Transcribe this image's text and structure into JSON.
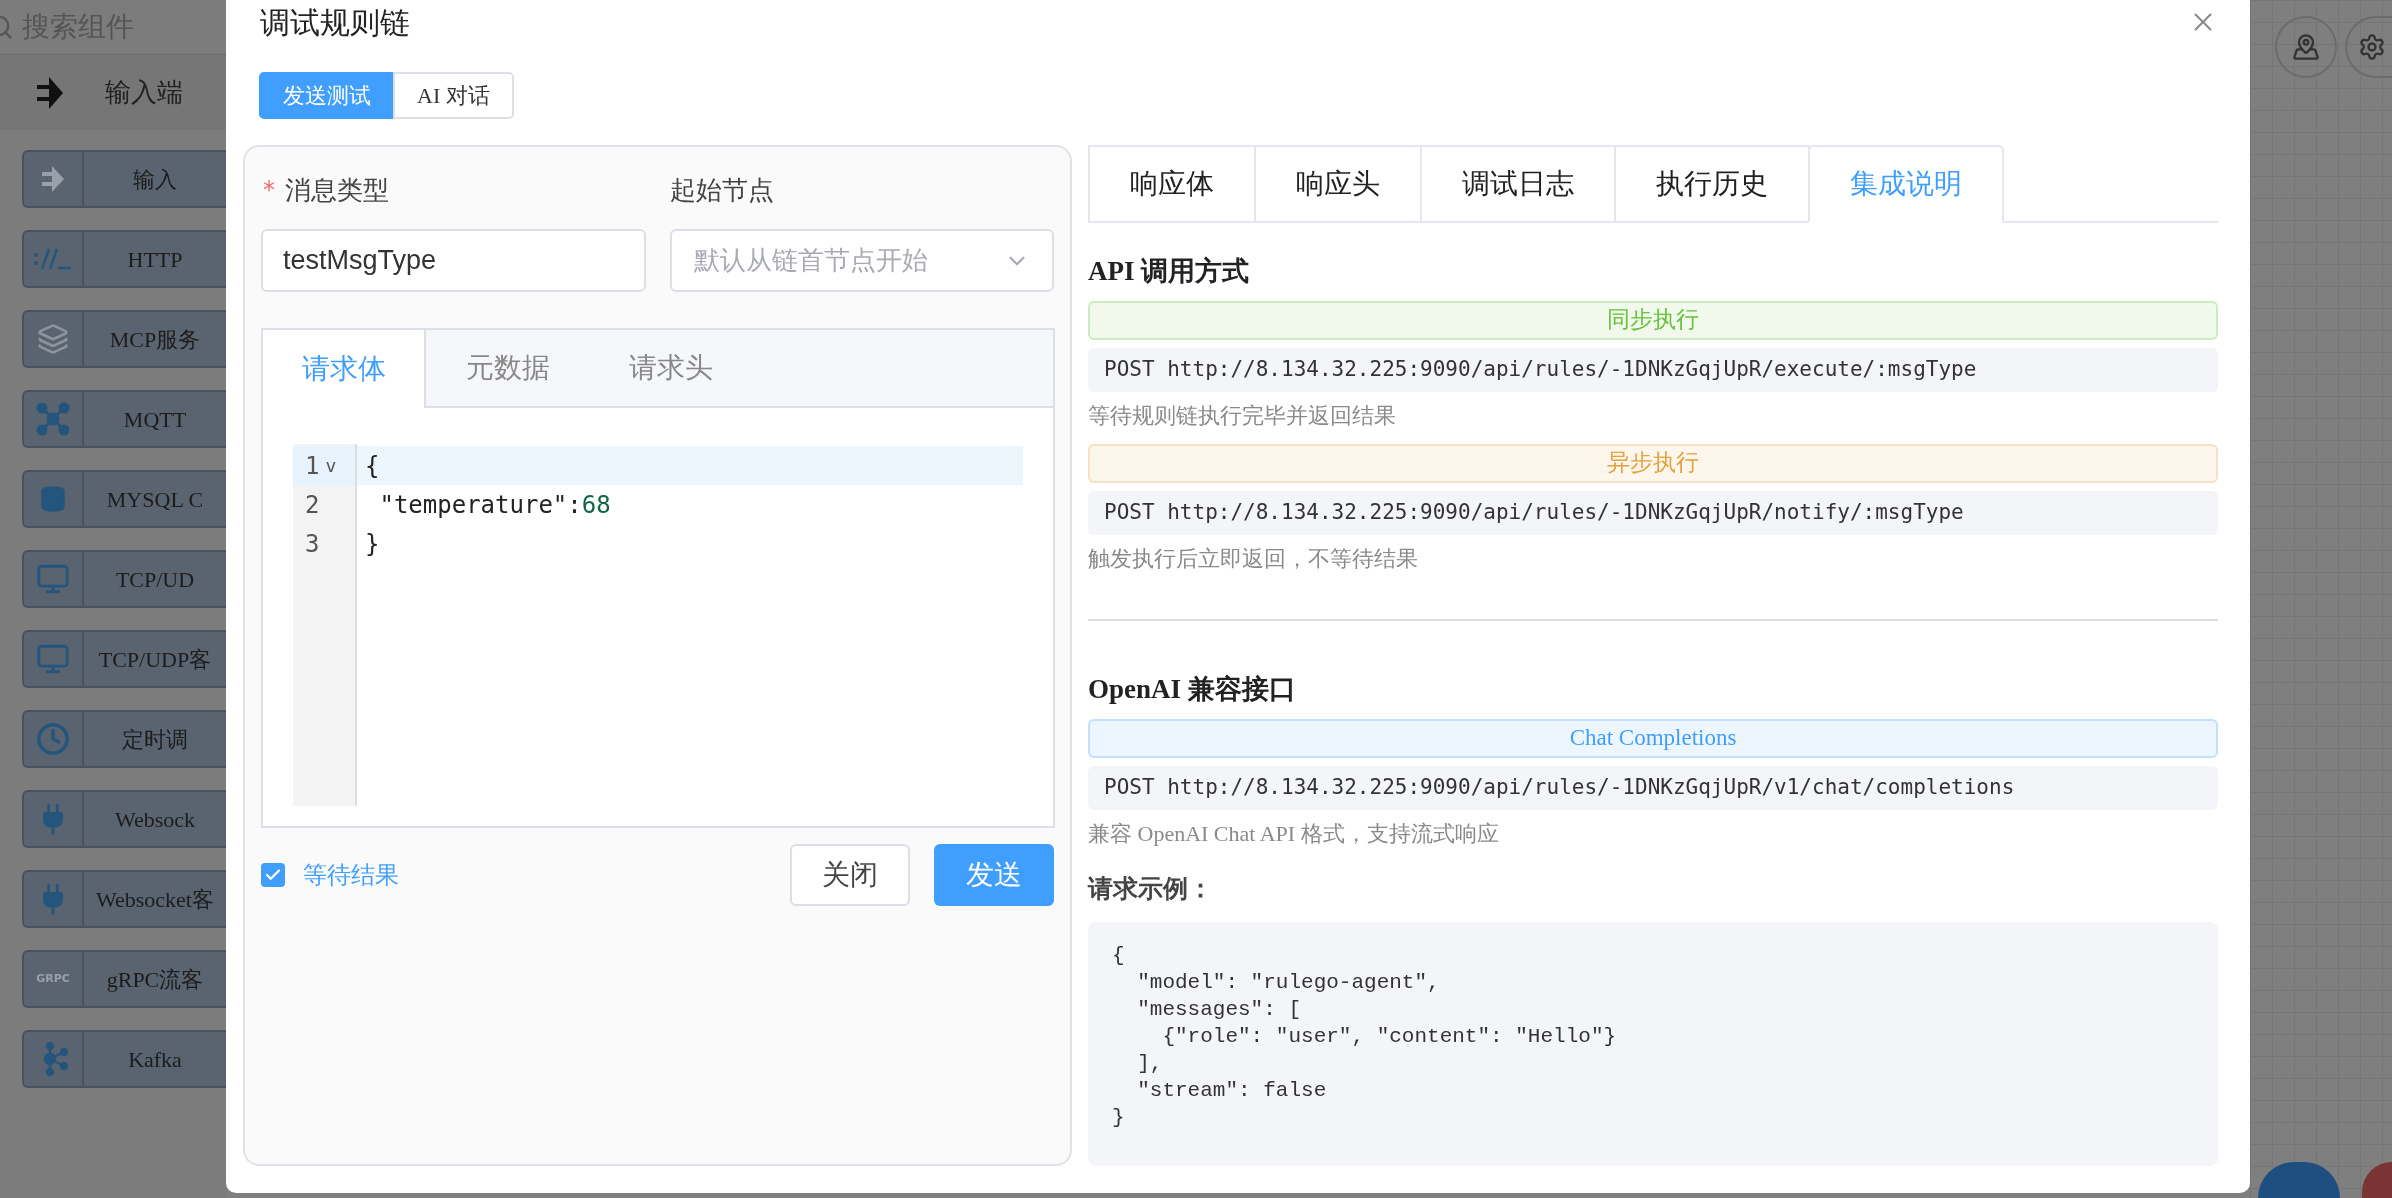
{
  "sidebar": {
    "search_placeholder": "搜索组件",
    "group": {
      "label": "输入端"
    },
    "items": [
      {
        "label": "输入",
        "kind": "arrow"
      },
      {
        "label": "HTTP",
        "kind": "http"
      },
      {
        "label": "MCP服务",
        "kind": "layers"
      },
      {
        "label": "MQTT",
        "kind": "hub"
      },
      {
        "label": "MYSQL C",
        "kind": "database"
      },
      {
        "label": "TCP/UD",
        "kind": "monitors"
      },
      {
        "label": "TCP/UDP客",
        "kind": "monitors"
      },
      {
        "label": "定时调",
        "kind": "clock"
      },
      {
        "label": "Websock",
        "kind": "plug"
      },
      {
        "label": "Websocket客",
        "kind": "plug"
      },
      {
        "label": "gRPC流客",
        "kind": "grpc",
        "icon_text": "GRPC"
      },
      {
        "label": "Kafka",
        "kind": "cluster"
      }
    ]
  },
  "dialog": {
    "title": "调试规则链",
    "mode_tabs": [
      {
        "label": "发送测试",
        "selected": true
      },
      {
        "label": "AI 对话",
        "selected": false
      }
    ],
    "message_type": {
      "label": "消息类型",
      "required_mark": "*",
      "value": "testMsgType"
    },
    "start_node": {
      "label": "起始节点",
      "placeholder": "默认从链首节点开始"
    },
    "body_tabs": [
      {
        "label": "请求体",
        "selected": true
      },
      {
        "label": "元数据",
        "selected": false
      },
      {
        "label": "请求头",
        "selected": false
      }
    ],
    "editor_lines": [
      {
        "number": "1",
        "fold_marker": "v",
        "active": true,
        "segments": [
          {
            "text": "{",
            "kind": "punct"
          }
        ]
      },
      {
        "number": "2",
        "active": false,
        "segments": [
          {
            "text": " \"temperature\"",
            "kind": "key"
          },
          {
            "text": ":",
            "kind": "punct"
          },
          {
            "text": "68",
            "kind": "number"
          }
        ]
      },
      {
        "number": "3",
        "active": false,
        "segments": [
          {
            "text": "}",
            "kind": "punct"
          }
        ]
      }
    ],
    "wait_result": {
      "label": "等待结果",
      "checked": true
    },
    "buttons": [
      {
        "label": "关闭",
        "kind": "default"
      },
      {
        "label": "发送",
        "kind": "primary"
      }
    ],
    "result_tabs": [
      {
        "label": "响应体",
        "selected": false
      },
      {
        "label": "响应头",
        "selected": false
      },
      {
        "label": "调试日志",
        "selected": false
      },
      {
        "label": "执行历史",
        "selected": false
      },
      {
        "label": "集成说明",
        "selected": true
      }
    ],
    "sections": [
      {
        "heading": "API 调用方式",
        "endpoints": [
          {
            "label": "同步执行",
            "color": "#67c23a",
            "request": "POST http://8.134.32.225:9090/api/rules/-1DNKzGqjUpR/execute/:msgType",
            "description": "等待规则链执行完毕并返回结果"
          },
          {
            "label": "异步执行",
            "color": "#e6a23c",
            "request": "POST http://8.134.32.225:9090/api/rules/-1DNKzGqjUpR/notify/:msgType",
            "description": "触发执行后立即返回，不等待结果"
          }
        ]
      },
      {
        "heading": "OpenAI 兼容接口",
        "endpoints": [
          {
            "label": "Chat Completions",
            "color": "#409eff",
            "request": "POST http://8.134.32.225:9090/api/rules/-1DNKzGqjUpR/v1/chat/completions",
            "description": "兼容 OpenAI Chat API 格式，支持流式响应"
          }
        ],
        "example": {
          "heading": "请求示例：",
          "code": "{\n  \"model\": \"rulego-agent\",\n  \"messages\": [\n    {\"role\": \"user\", \"content\": \"Hello\"}\n  ],\n  \"stream\": false\n}"
        }
      }
    ]
  }
}
